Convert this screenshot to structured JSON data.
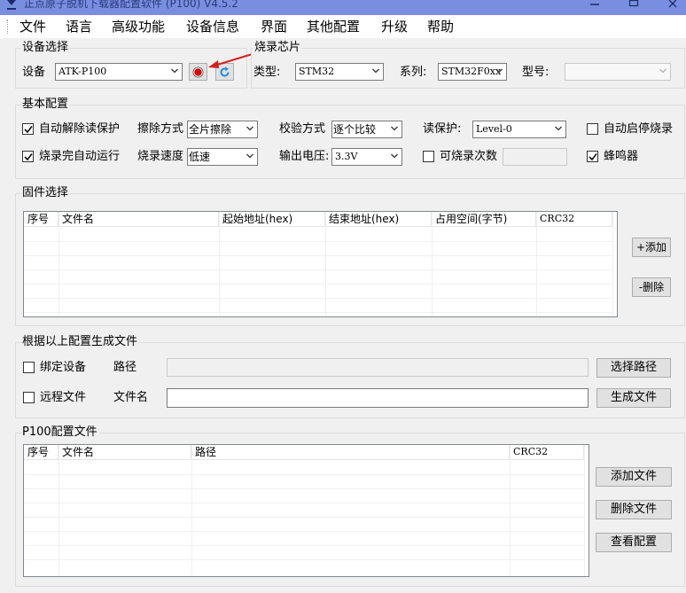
{
  "window": {
    "title": "正点原子脱机下载器配置软件 (P100)  V4.5.2"
  },
  "menu": [
    "文件",
    "语言",
    "高级功能",
    "设备信息",
    "界面",
    "其他配置",
    "升级",
    "帮助"
  ],
  "device_select": {
    "title": "设备选择",
    "device_label": "设备",
    "device_value": "ATK-P100"
  },
  "chip": {
    "title": "烧录芯片",
    "type_label": "类型:",
    "type_value": "STM32",
    "series_label": "系列:",
    "series_value": "STM32F0xx",
    "model_label": "型号:",
    "model_value": ""
  },
  "basic": {
    "title": "基本配置",
    "auto_unprotect": {
      "label": "自动解除读保护",
      "checked": true
    },
    "erase_label": "擦除方式",
    "erase_value": "全片擦除",
    "verify_label": "校验方式",
    "verify_value": "逐个比较",
    "readprot_label": "读保护:",
    "readprot_value": "Level-0",
    "auto_start": {
      "label": "自动启停烧录",
      "checked": false
    },
    "auto_run": {
      "label": "烧录完自动运行",
      "checked": true
    },
    "speed_label": "烧录速度",
    "speed_value": "低速",
    "voltage_label": "输出电压:",
    "voltage_value": "3.3V",
    "count_enable": {
      "label": "可烧录次数",
      "checked": false
    },
    "buzzer": {
      "label": "蜂鸣器",
      "checked": true
    }
  },
  "firmware": {
    "title": "固件选择",
    "columns": [
      "序号",
      "文件名",
      "起始地址(hex)",
      "结束地址(hex)",
      "占用空间(字节)",
      "CRC32"
    ],
    "rows": [],
    "add_label": "+添加",
    "remove_label": "-删除"
  },
  "generate": {
    "title": "根据以上配置生成文件",
    "bind_device": {
      "label": "绑定设备",
      "checked": false
    },
    "path_label": "路径",
    "path_value": "",
    "choose_path_label": "选择路径",
    "remote_file": {
      "label": "远程文件",
      "checked": false
    },
    "filename_label": "文件名",
    "filename_value": "",
    "generate_label": "生成文件"
  },
  "p100": {
    "title": "P100配置文件",
    "columns": [
      "序号",
      "文件名",
      "路径",
      "CRC32"
    ],
    "rows": [],
    "add_label": "添加文件",
    "delete_label": "删除文件",
    "view_label": "查看配置"
  },
  "colors": {
    "titlebar": "#7a8ee0",
    "record_button": "#e00000",
    "refresh_icon": "#1e8fe0",
    "annotation_arrow": "#d42020"
  },
  "icons": {
    "app": "download-arrow-icon",
    "record": "record-icon",
    "refresh": "refresh-icon",
    "annotation": "red-arrow-icon"
  }
}
